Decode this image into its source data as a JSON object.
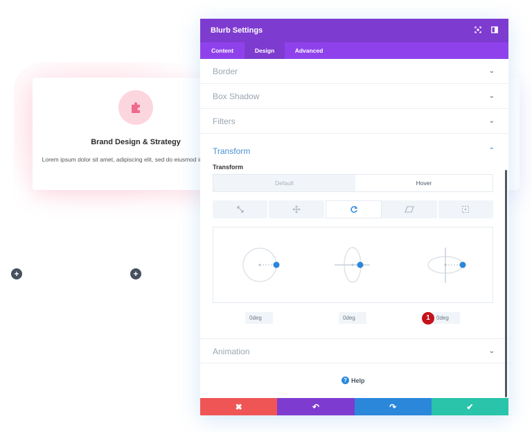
{
  "card": {
    "title": "Brand Design & Strategy",
    "text": "Lorem ipsum dolor sit amet, adipiscing elit, sed do eiusmod incididunt ut",
    "icon": "puzzle-icon",
    "icon_color": "#f06a8c"
  },
  "modal": {
    "title": "Blurb Settings",
    "header_icons": [
      "fullscreen-icon",
      "sidebar-toggle-icon"
    ],
    "tabs": [
      {
        "label": "Content",
        "active": false
      },
      {
        "label": "Design",
        "active": true
      },
      {
        "label": "Advanced",
        "active": false
      }
    ],
    "sections": {
      "border": "Border",
      "box_shadow": "Box Shadow",
      "filters": "Filters",
      "transform": "Transform",
      "animation": "Animation"
    },
    "transform": {
      "sub_label": "Transform",
      "modes": {
        "default": "Default",
        "hover": "Hover",
        "selected": "Hover"
      },
      "tools": [
        "scale-icon",
        "translate-icon",
        "rotate-icon",
        "skew-icon",
        "origin-icon"
      ],
      "selected_tool": "rotate-icon",
      "rotate_values": [
        "0deg",
        "0deg",
        "0deg"
      ]
    },
    "help_label": "Help",
    "badge": "1",
    "footer": {
      "cancel": "✖",
      "undo": "↶",
      "redo": "↷",
      "save": "✔"
    }
  },
  "colors": {
    "header": "#7e3bd0",
    "tabs": "#8f42ec",
    "accent": "#2b87da",
    "cancel": "#ef5555",
    "undo": "#7e3bd0",
    "redo": "#2b87da",
    "save": "#29c4a9"
  }
}
